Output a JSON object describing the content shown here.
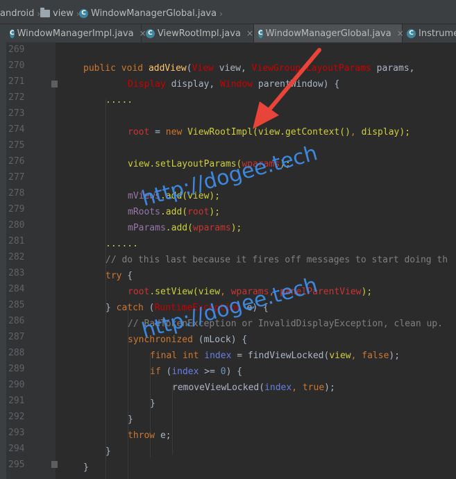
{
  "breadcrumb": [
    {
      "label": "android",
      "icon": "folder-icon"
    },
    {
      "label": "view",
      "icon": "folder-icon"
    },
    {
      "label": "WindowManagerGlobal.java",
      "icon": "class-icon"
    }
  ],
  "tabs": [
    {
      "label": "WindowManagerImpl.java",
      "active": false
    },
    {
      "label": "ViewRootImpl.java",
      "active": false
    },
    {
      "label": "WindowManagerGlobal.java",
      "active": true
    },
    {
      "label": "Instrume",
      "active": false
    }
  ],
  "class_icon_letter": "C",
  "tab_close_glyph": "×",
  "line_numbers": [
    "269",
    "270",
    "271",
    "272",
    "273",
    "274",
    "275",
    "276",
    "277",
    "278",
    "279",
    "280",
    "281",
    "282",
    "283",
    "284",
    "285",
    "286",
    "287",
    "288",
    "289",
    "290",
    "291",
    "292",
    "293",
    "294",
    "295"
  ],
  "watermark": {
    "text": "http://dogee.tech",
    "color": "#3e8ee6"
  },
  "arrow_color": "#e8443a",
  "colors": {
    "background": "#2b2b2b",
    "keyword": "#cc7832",
    "method": "#ffc66d",
    "comment": "#808080"
  },
  "code": {
    "l270_public": "public",
    "l270_void": "void",
    "l270_method": "addView",
    "l270_open": "(",
    "l270_type1": "View",
    "l270_param1": " view, ",
    "l270_type2": "ViewGroup.LayoutParams",
    "l270_param2": " params,",
    "l271_type": "Display",
    "l271_param": " display, ",
    "l271_type2": "Window",
    "l271_param2": " parentWindow) {",
    "l272": ".....",
    "l274_var": "root",
    "l274_eq": " = ",
    "l274_new": "new",
    "l274_ctor": " ViewRootImpl(",
    "l274_arg": "view.getContext()",
    "l274_comma": ", ",
    "l274_disp": "display",
    "l274_end": ");",
    "l276_recv": "view",
    "l276_call": ".setLayoutParams(",
    "l276_arg": "wparams",
    "l276_end": ");",
    "l278_field": "mViews",
    "l278_call": ".add(",
    "l278_arg": "view",
    "l278_end": ");",
    "l279_field": "mRoots",
    "l279_call": ".add(",
    "l279_arg": "root",
    "l279_end": ");",
    "l280_field": "mParams",
    "l280_call": ".add(",
    "l280_arg": "wparams",
    "l280_end": ");",
    "l281": "......",
    "l282": "// do this last because it fires off messages to start doing th",
    "l283_try": "try",
    "l283_brace": " {",
    "l284_var": "root",
    "l284_call": ".setView(",
    "l284_a1": "view",
    "l284_c1": ", ",
    "l284_a2": "wparams",
    "l284_c2": ", ",
    "l284_a3": "panelParentView",
    "l284_end": ");",
    "l285_brace": "} ",
    "l285_catch": "catch",
    "l285_open": " (",
    "l285_type": "RuntimeException",
    "l285_end": " e) {",
    "l286": "// BadTokenException or InvalidDisplayException, clean up.",
    "l287_sync": "synchronized",
    "l287_rest": " (mLock) {",
    "l288_final": "final",
    "l288_int": " int",
    "l288_idx": " index",
    "l288_eq": " = ",
    "l288_call": "findViewLocked(",
    "l288_a1": "view",
    "l288_c": ", ",
    "l288_false": "false",
    "l288_end": ");",
    "l289_if": "if",
    "l289_open": " (",
    "l289_idx": "index",
    "l289_op": " >= ",
    "l289_zero": "0",
    "l289_end": ") {",
    "l290_call": "removeViewLocked(",
    "l290_idx": "index",
    "l290_c": ", ",
    "l290_true": "true",
    "l290_end": ");",
    "l291": "}",
    "l292": "}",
    "l293_throw": "throw",
    "l293_e": " e;",
    "l294": "}",
    "l295": "}"
  }
}
